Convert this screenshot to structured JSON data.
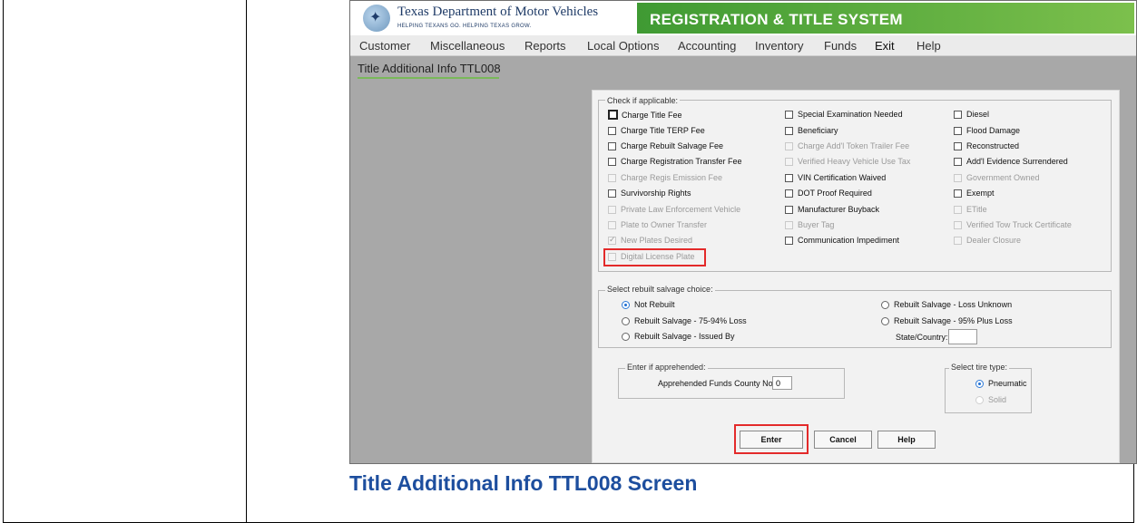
{
  "app": {
    "brand_name": "Texas Department of Motor Vehicles",
    "brand_tagline": "HELPING TEXANS GO. HELPING TEXAS GROW.",
    "system_title": "REGISTRATION & TITLE SYSTEM"
  },
  "menu": [
    "Customer",
    "Miscellaneous",
    "Reports",
    "Local Options",
    "Accounting",
    "Inventory",
    "Funds",
    "Exit",
    "Help"
  ],
  "page_title": "Title Additional Info TTL008",
  "checks": {
    "label": "Check if applicable:",
    "col1": [
      {
        "label": "Charge Title Fee",
        "checked": false,
        "enabled": true
      },
      {
        "label": "Charge Title TERP Fee",
        "checked": false,
        "enabled": true
      },
      {
        "label": "Charge Rebuilt Salvage Fee",
        "checked": false,
        "enabled": true
      },
      {
        "label": "Charge Registration Transfer Fee",
        "checked": false,
        "enabled": true
      },
      {
        "label": "Charge Regis Emission Fee",
        "checked": false,
        "enabled": false
      },
      {
        "label": "Survivorship Rights",
        "checked": false,
        "enabled": true
      },
      {
        "label": "Private Law Enforcement Vehicle",
        "checked": false,
        "enabled": false
      },
      {
        "label": "Plate to Owner Transfer",
        "checked": false,
        "enabled": false
      },
      {
        "label": "New Plates Desired",
        "checked": true,
        "enabled": false
      },
      {
        "label": "Digital License Plate",
        "checked": false,
        "enabled": false
      }
    ],
    "col2": [
      {
        "label": "Special Examination Needed",
        "checked": false,
        "enabled": true
      },
      {
        "label": "Beneficiary",
        "checked": false,
        "enabled": true
      },
      {
        "label": "Charge Add'l Token Trailer Fee",
        "checked": false,
        "enabled": false
      },
      {
        "label": "Verified Heavy Vehicle Use Tax",
        "checked": false,
        "enabled": false
      },
      {
        "label": "VIN Certification Waived",
        "checked": false,
        "enabled": true
      },
      {
        "label": "DOT Proof Required",
        "checked": false,
        "enabled": true
      },
      {
        "label": "Manufacturer Buyback",
        "checked": false,
        "enabled": true
      },
      {
        "label": "Buyer Tag",
        "checked": false,
        "enabled": false
      },
      {
        "label": "Communication Impediment",
        "checked": false,
        "enabled": true
      }
    ],
    "col3": [
      {
        "label": "Diesel",
        "checked": false,
        "enabled": true
      },
      {
        "label": "Flood Damage",
        "checked": false,
        "enabled": true
      },
      {
        "label": "Reconstructed",
        "checked": false,
        "enabled": true
      },
      {
        "label": "Add'l Evidence Surrendered",
        "checked": false,
        "enabled": true
      },
      {
        "label": "Government Owned",
        "checked": false,
        "enabled": false
      },
      {
        "label": "Exempt",
        "checked": false,
        "enabled": true
      },
      {
        "label": "ETitle",
        "checked": false,
        "enabled": false
      },
      {
        "label": "Verified Tow Truck Certificate",
        "checked": false,
        "enabled": false
      },
      {
        "label": "Dealer Closure",
        "checked": false,
        "enabled": false
      }
    ]
  },
  "salvage": {
    "label": "Select rebuilt salvage choice:",
    "not_rebuilt": "Not Rebuilt",
    "loss_unknown": "Rebuilt Salvage - Loss Unknown",
    "loss_75_94": "Rebuilt Salvage - 75-94% Loss",
    "loss_95_plus": "Rebuilt Salvage - 95% Plus Loss",
    "issued_by": "Rebuilt Salvage - Issued By",
    "state_country_label": "State/Country:",
    "state_country_value": "",
    "selected": "Not Rebuilt"
  },
  "apprehended": {
    "label": "Enter if apprehended:",
    "field_label": "Apprehended Funds County No:",
    "field_value": "0"
  },
  "tire": {
    "label": "Select tire type:",
    "pneumatic": "Pneumatic",
    "solid": "Solid",
    "selected": "Pneumatic"
  },
  "buttons": {
    "enter": "Enter",
    "cancel": "Cancel",
    "help": "Help"
  },
  "caption": "Title Additional Info TTL008 Screen",
  "colors": {
    "highlight": "#e32a2a",
    "system_band": "#5aa83c",
    "caption": "#1d4e9e"
  }
}
